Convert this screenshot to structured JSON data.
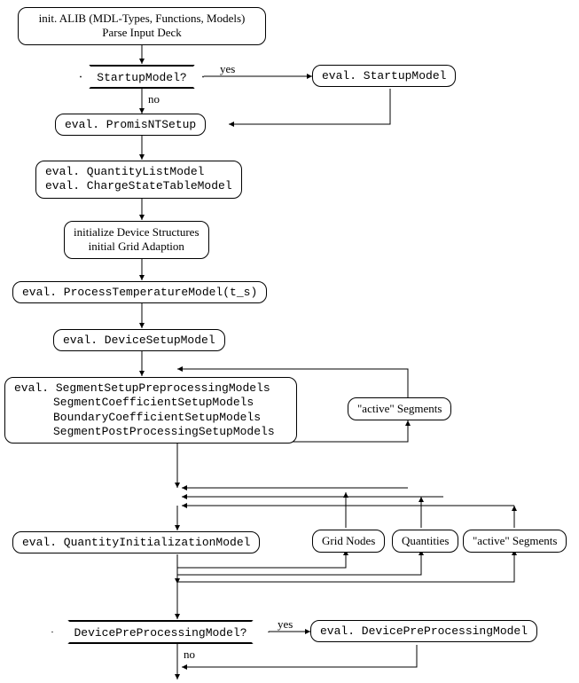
{
  "nodes": {
    "n1_l1": "init. ALIB (MDL-Types, Functions, Models)",
    "n1_l2": "Parse Input Deck",
    "d1": "StartupModel?",
    "d1_yes": "yes",
    "d1_no": "no",
    "n2": "eval. StartupModel",
    "n3": "eval. PromisNTSetup",
    "n4_l1": "eval. QuantityListModel",
    "n4_l2": "eval. ChargeStateTableModel",
    "n5_l1": "initialize Device Structures",
    "n5_l2": "initial Grid Adaption",
    "n6": "eval. ProcessTemperatureModel(t_s)",
    "n7": "eval. DeviceSetupModel",
    "n8_prefix": "eval. ",
    "n8_l1": "SegmentSetupPreprocessingModels",
    "n8_l2": "SegmentCoefficientSetupModels",
    "n8_l3": "BoundaryCoefficientSetupModels",
    "n8_l4": "SegmentPostProcessingSetupModels",
    "loop1": "\"active\" Segments",
    "n9": "eval. QuantityInitializationModel",
    "loop2a": "Grid Nodes",
    "loop2b": "Quantities",
    "loop2c": "\"active\" Segments",
    "d2": "DevicePreProcessingModel?",
    "d2_yes": "yes",
    "d2_no": "no",
    "n10": "eval. DevicePreProcessingModel"
  }
}
